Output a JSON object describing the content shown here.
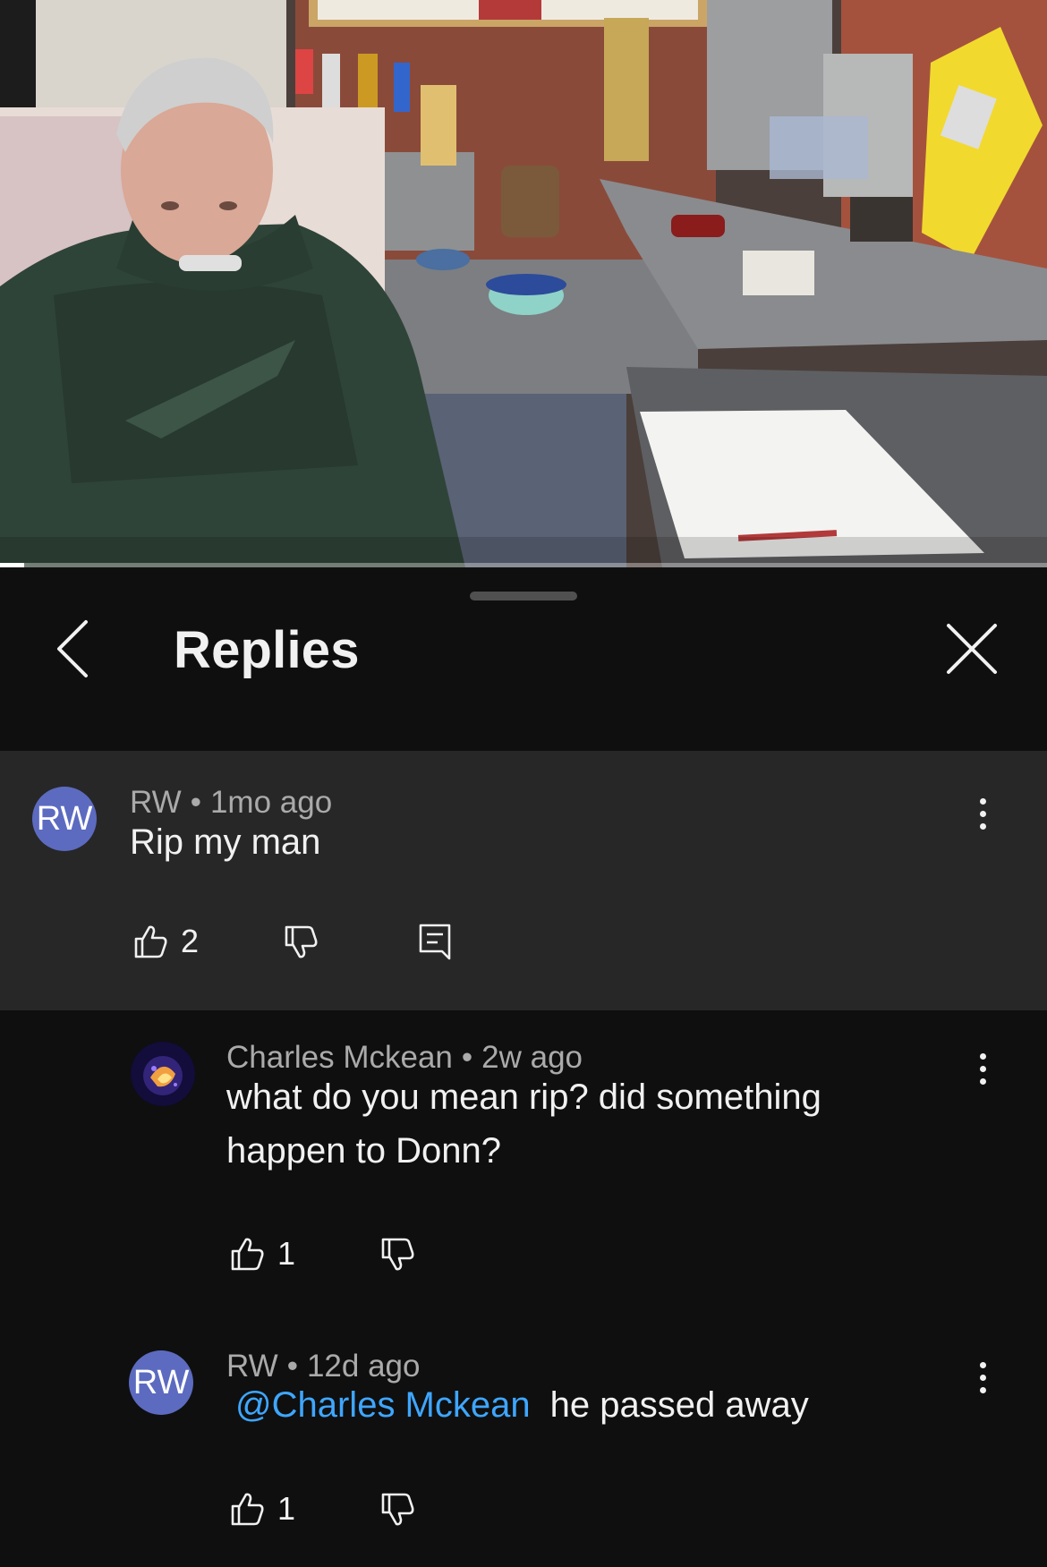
{
  "video": {
    "progress_fraction": 0.023
  },
  "panel": {
    "title": "Replies",
    "back_icon": "chevron-left-icon",
    "close_icon": "close-icon"
  },
  "parent_comment": {
    "avatar_initials": "RW",
    "avatar_color": "#5c6bc0",
    "author": "RW",
    "separator": "•",
    "time": "1mo ago",
    "text": "Rip my man",
    "likes": "2"
  },
  "replies": [
    {
      "author": "Charles Mckean",
      "separator": "•",
      "time": "2w ago",
      "text_line1": "what do you mean rip? did something",
      "text_line2": "happen to Donn?",
      "likes": "1"
    },
    {
      "avatar_initials": "RW",
      "avatar_color": "#5c6bc0",
      "author": "RW",
      "separator": "•",
      "time": "12d ago",
      "mention": "@Charles Mckean",
      "text": "he passed away",
      "likes": "1"
    }
  ],
  "colors": {
    "background": "#0f0f0f",
    "highlight": "#272727",
    "mention": "#3ea6ff",
    "meta": "#aaaaaa"
  }
}
